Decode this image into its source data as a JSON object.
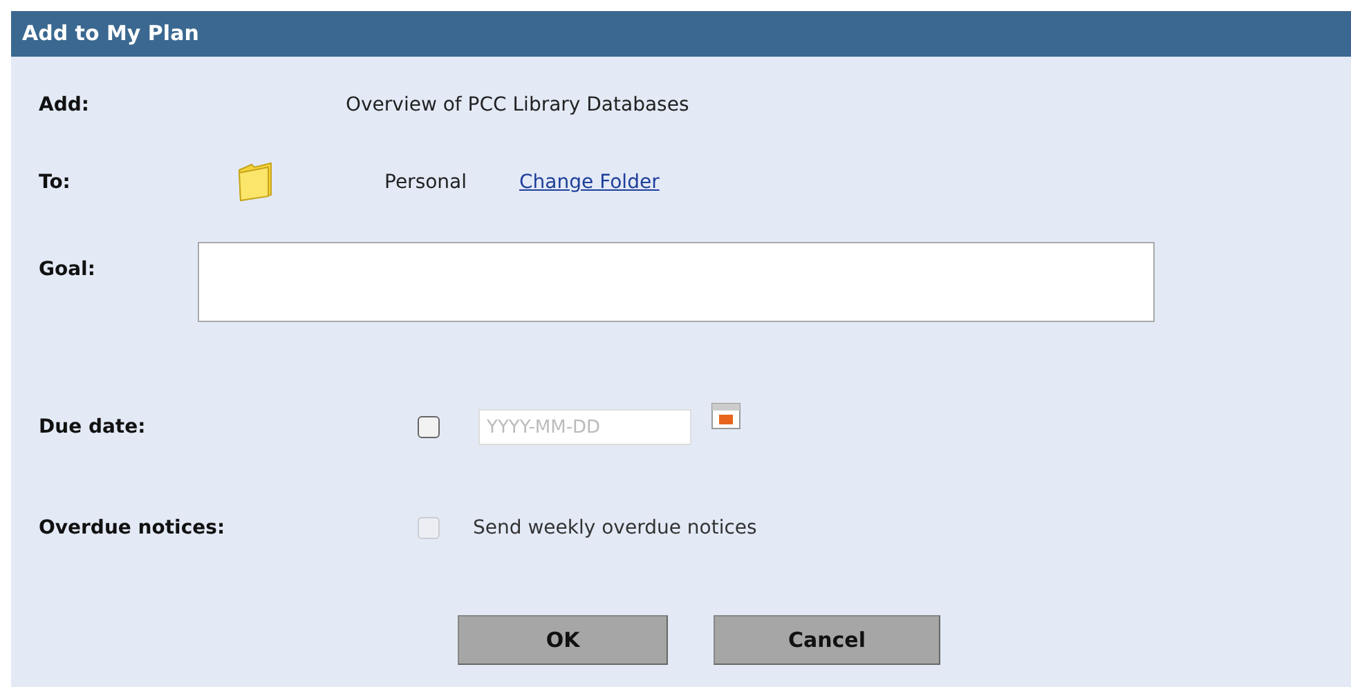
{
  "window": {
    "title": "Add to My Plan"
  },
  "add": {
    "label": "Add:",
    "value": "Overview of PCC Library Databases"
  },
  "to": {
    "label": "To:",
    "folder": "Personal",
    "link": "Change Folder"
  },
  "goal": {
    "label": "Goal:"
  },
  "due_date": {
    "label": "Due date:",
    "checked": false,
    "placeholder": "YYYY-MM-DD"
  },
  "overdue": {
    "label": "Overdue notices:",
    "checked": false,
    "disabled": true,
    "text": "Send weekly overdue notices"
  },
  "buttons": [
    {
      "label": "OK"
    },
    {
      "label": "Cancel"
    }
  ]
}
